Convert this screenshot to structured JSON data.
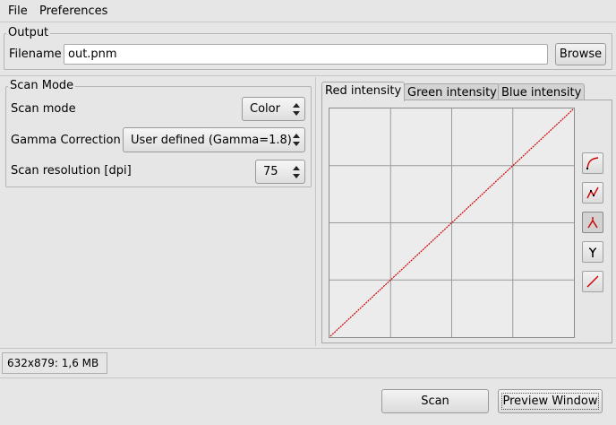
{
  "menu": {
    "file": "File",
    "preferences": "Preferences"
  },
  "output": {
    "legend": "Output",
    "filename_label": "Filename",
    "filename_value": "out.pnm",
    "browse_label": "Browse"
  },
  "scan_mode": {
    "legend": "Scan Mode",
    "mode_label": "Scan mode",
    "mode_value": "Color",
    "gamma_label": "Gamma Correction",
    "gamma_value": "User defined (Gamma=1.8)",
    "resolution_label": "Scan resolution [dpi]",
    "resolution_value": "75"
  },
  "tabs": [
    {
      "label": "Red intensity",
      "active": true
    },
    {
      "label": "Green intensity",
      "active": false
    },
    {
      "label": "Blue intensity",
      "active": false
    }
  ],
  "curve": {
    "color": "#cc0000",
    "grid_divisions": 4
  },
  "curve_tools": [
    {
      "icon": "free-curve-icon",
      "active": false
    },
    {
      "icon": "spline-curve-icon",
      "active": false
    },
    {
      "icon": "linear-curve-icon",
      "active": true
    },
    {
      "icon": "gamma-icon",
      "active": false
    },
    {
      "icon": "reset-linear-icon",
      "active": false
    }
  ],
  "status": {
    "image_info": "632x879: 1,6 MB"
  },
  "actions": {
    "scan_label": "Scan",
    "preview_label": "Preview Window"
  }
}
